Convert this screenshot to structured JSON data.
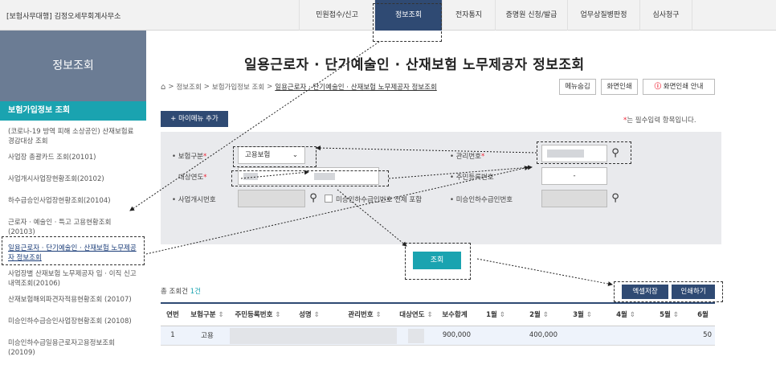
{
  "topbar": {
    "office": "[보험사무대행] 김정오세무회계사무소",
    "nav": [
      {
        "label": "민원접수/신고"
      },
      {
        "label": "정보조회"
      },
      {
        "label": "전자통지"
      },
      {
        "label": "증명원 신청/발급"
      },
      {
        "label": "업무상질병판정"
      },
      {
        "label": "심사청구"
      }
    ]
  },
  "sidebar": {
    "title": "정보조회",
    "section": "보험가입정보 조회",
    "items": [
      {
        "label": "(코로나-19 방역 피해 소상공인) 산재보험료 경감대상 조회"
      },
      {
        "label": "사업장 총괄카드 조회(20101)"
      },
      {
        "label": "사업개시사업장현황조회(20102)"
      },
      {
        "label": "하수급승인사업장현황조회(20104)"
      },
      {
        "label": "근로자 · 예술인 · 특고 고용현황조회 (20103)"
      },
      {
        "label": "일용근로자 · 단기예술인 · 산재보험 노무제공자 정보조회"
      },
      {
        "label": "사업장별 산재보험 노무제공자 입 · 이직 신고내역조회(20106)"
      },
      {
        "label": "산재보험해외파견자적용현황조회 (20107)"
      },
      {
        "label": "미승인하수급승인사업장현황조회 (20108)"
      },
      {
        "label": "미승인하수급일용근로자고용정보조회 (20109)"
      }
    ]
  },
  "main": {
    "title": "일용근로자 · 단기예술인 · 산재보험 노무제공자 정보조회",
    "breadcrumb": [
      "정보조회",
      "보험가입정보 조회",
      "일용근로자 · 단기예술인 · 산재보험 노무제공자 정보조회"
    ],
    "buttons": {
      "hide_menu": "메뉴숨김",
      "print": "화면인쇄",
      "print_guide": "화면인쇄 안내",
      "my_menu": "+ 마이메뉴 추가",
      "search": "조회",
      "excel": "엑셀저장",
      "print2": "인쇄하기"
    },
    "required_note": "는 필수입력 항목입니다.",
    "form": {
      "insurance_type_label": "보험구분",
      "insurance_type_value": "고용보험",
      "mgmt_no_label": "관리번호",
      "target_year_label": "대상연도",
      "rrn_label": "주민등록번호",
      "rrn_dash": "-",
      "biz_no_label": "사업개시번호",
      "unapproved_check_label": "미승인하수급인번호 전체 포함",
      "unapproved_no_label": "미승인하수급인번호"
    },
    "total": {
      "prefix": "총 조회건",
      "count": "1건"
    },
    "table": {
      "headers": [
        "연번",
        "보험구분",
        "주민등록번호",
        "성명",
        "관리번호",
        "대상연도",
        "보수합계",
        "1월",
        "2월",
        "3월",
        "4월",
        "5월",
        "6월"
      ],
      "rows": [
        [
          "1",
          "고용",
          "",
          "",
          "",
          "",
          "900,000",
          "",
          "400,000",
          "",
          "",
          "",
          "50"
        ]
      ]
    }
  },
  "colors": {
    "navy": "#2f4a73",
    "teal": "#1aa3b0",
    "required": "#e23"
  }
}
